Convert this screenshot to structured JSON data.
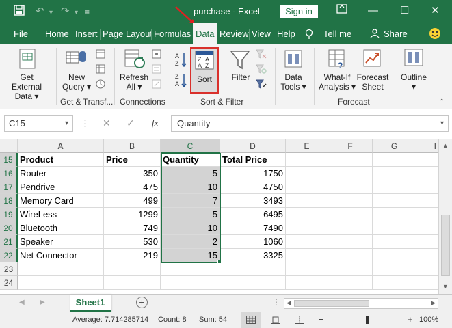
{
  "window": {
    "title": "purchase - Excel",
    "signin_label": "Sign in"
  },
  "tabs": [
    "File",
    "Home",
    "Insert",
    "Page Layout",
    "Formulas",
    "Data",
    "Review",
    "View",
    "Help",
    "Tell me",
    "Share"
  ],
  "ribbon": {
    "get_external_data": [
      "Get External",
      "Data"
    ],
    "new_query": [
      "New",
      "Query"
    ],
    "refresh_all": [
      "Refresh",
      "All"
    ],
    "sort": "Sort",
    "filter": "Filter",
    "data_tools": [
      "Data",
      "Tools"
    ],
    "what_if": [
      "What-If",
      "Analysis"
    ],
    "forecast_sheet": [
      "Forecast",
      "Sheet"
    ],
    "outline": "Outline",
    "groups": {
      "get_transform": "Get & Transf...",
      "connections": "Connections",
      "sort_filter": "Sort & Filter",
      "forecast": "Forecast"
    }
  },
  "formula_bar": {
    "name_box": "C15",
    "fx": "fx",
    "content": "Quantity"
  },
  "columns": [
    "A",
    "B",
    "C",
    "D",
    "E",
    "F",
    "G",
    "I"
  ],
  "rows": [
    {
      "n": "15",
      "cells": [
        "Product",
        "Price",
        "Quantity",
        "Total Price"
      ]
    },
    {
      "n": "16",
      "cells": [
        "Router",
        "350",
        "5",
        "1750"
      ]
    },
    {
      "n": "17",
      "cells": [
        "Pendrive",
        "475",
        "10",
        "4750"
      ]
    },
    {
      "n": "18",
      "cells": [
        "Memory Card",
        "499",
        "7",
        "3493"
      ]
    },
    {
      "n": "19",
      "cells": [
        "WireLess",
        "1299",
        "5",
        "6495"
      ]
    },
    {
      "n": "20",
      "cells": [
        "Bluetooth",
        "749",
        "10",
        "7490"
      ]
    },
    {
      "n": "21",
      "cells": [
        "Speaker",
        "530",
        "2",
        "1060"
      ]
    },
    {
      "n": "22",
      "cells": [
        "Net Connector",
        "219",
        "15",
        "3325"
      ]
    },
    {
      "n": "23",
      "cells": [
        "",
        "",
        "",
        ""
      ]
    },
    {
      "n": "24",
      "cells": [
        "",
        "",
        "",
        ""
      ]
    }
  ],
  "sheet_tab": "Sheet1",
  "status": {
    "average": "Average: 7.714285714",
    "count": "Count: 8",
    "sum": "Sum: 54",
    "zoom": "100%",
    "zoom_level": 1.0
  },
  "colors": {
    "accent": "#217346",
    "highlight_border": "#d9302b",
    "selection": "#d3d3d3"
  }
}
